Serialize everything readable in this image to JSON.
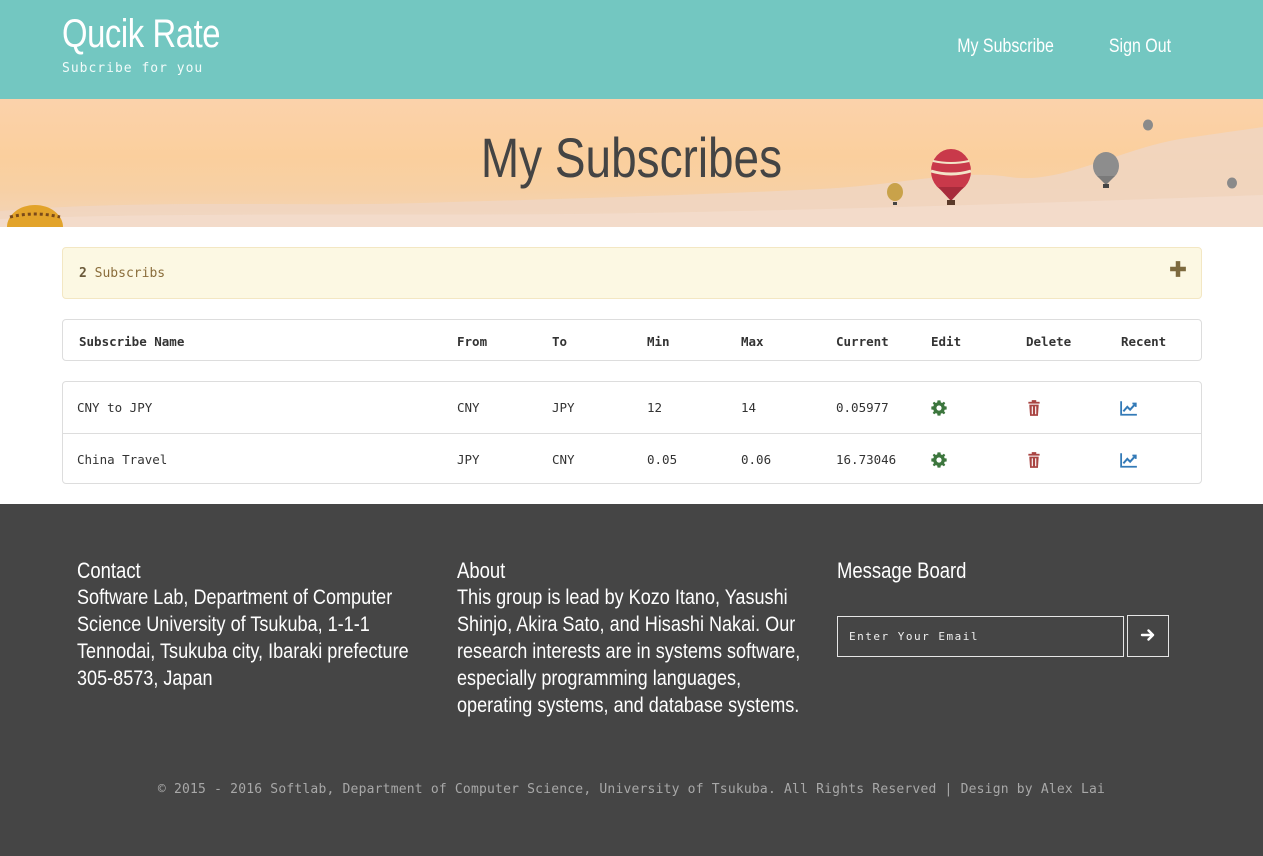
{
  "header": {
    "title": "Qucik Rate",
    "subtitle": "Subcribe for you",
    "nav": [
      {
        "label": "My Subscribe"
      },
      {
        "label": "Sign Out"
      }
    ]
  },
  "banner": {
    "title": "My Subscribes"
  },
  "summary": {
    "count": "2",
    "label": "Subscribs",
    "add_icon": "plus-icon"
  },
  "table": {
    "columns": [
      "Subscribe Name",
      "From",
      "To",
      "Min",
      "Max",
      "Current",
      "Edit",
      "Delete",
      "Recent"
    ],
    "rows": [
      {
        "name": "CNY to JPY",
        "from": "CNY",
        "to": "JPY",
        "min": "12",
        "max": "14",
        "current": "0.05977"
      },
      {
        "name": "China Travel",
        "from": "JPY",
        "to": "CNY",
        "min": "0.05",
        "max": "0.06",
        "current": "16.73046"
      }
    ],
    "icons": {
      "edit": "gear-icon",
      "delete": "trash-icon",
      "recent": "line-chart-icon"
    },
    "colors": {
      "edit": "#3c763d",
      "delete": "#a94442",
      "recent": "#337ab7"
    }
  },
  "footer": {
    "contact": {
      "title": "Contact",
      "text": "Software Lab, Department of Computer Science University of Tsukuba, 1-1-1 Tennodai, Tsukuba city, Ibaraki prefecture 305-8573, Japan"
    },
    "about": {
      "title": "About",
      "text": "This group is lead by Kozo Itano, Yasushi Shinjo, Akira Sato, and Hisashi Nakai. Our research interests are in systems software, especially programming languages, operating systems, and database systems."
    },
    "message_board": {
      "title": "Message Board",
      "placeholder": "Enter Your Email",
      "send_icon": "arrow-right-icon"
    },
    "copyright": "© 2015 - 2016 Softlab, Department of Computer Science, University of Tsukuba. All Rights Reserved | Design by Alex Lai"
  },
  "colors": {
    "header_bg": "#73c7c1",
    "footer_bg": "#454545",
    "summary_bg": "#fcf8e3"
  }
}
